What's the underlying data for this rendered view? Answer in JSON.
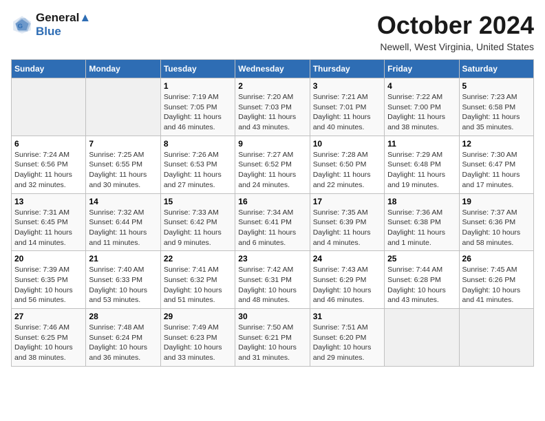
{
  "header": {
    "logo_line1": "General",
    "logo_line2": "Blue",
    "month": "October 2024",
    "location": "Newell, West Virginia, United States"
  },
  "days_of_week": [
    "Sunday",
    "Monday",
    "Tuesday",
    "Wednesday",
    "Thursday",
    "Friday",
    "Saturday"
  ],
  "weeks": [
    [
      {
        "day": "",
        "info": ""
      },
      {
        "day": "",
        "info": ""
      },
      {
        "day": "1",
        "info": "Sunrise: 7:19 AM\nSunset: 7:05 PM\nDaylight: 11 hours and 46 minutes."
      },
      {
        "day": "2",
        "info": "Sunrise: 7:20 AM\nSunset: 7:03 PM\nDaylight: 11 hours and 43 minutes."
      },
      {
        "day": "3",
        "info": "Sunrise: 7:21 AM\nSunset: 7:01 PM\nDaylight: 11 hours and 40 minutes."
      },
      {
        "day": "4",
        "info": "Sunrise: 7:22 AM\nSunset: 7:00 PM\nDaylight: 11 hours and 38 minutes."
      },
      {
        "day": "5",
        "info": "Sunrise: 7:23 AM\nSunset: 6:58 PM\nDaylight: 11 hours and 35 minutes."
      }
    ],
    [
      {
        "day": "6",
        "info": "Sunrise: 7:24 AM\nSunset: 6:56 PM\nDaylight: 11 hours and 32 minutes."
      },
      {
        "day": "7",
        "info": "Sunrise: 7:25 AM\nSunset: 6:55 PM\nDaylight: 11 hours and 30 minutes."
      },
      {
        "day": "8",
        "info": "Sunrise: 7:26 AM\nSunset: 6:53 PM\nDaylight: 11 hours and 27 minutes."
      },
      {
        "day": "9",
        "info": "Sunrise: 7:27 AM\nSunset: 6:52 PM\nDaylight: 11 hours and 24 minutes."
      },
      {
        "day": "10",
        "info": "Sunrise: 7:28 AM\nSunset: 6:50 PM\nDaylight: 11 hours and 22 minutes."
      },
      {
        "day": "11",
        "info": "Sunrise: 7:29 AM\nSunset: 6:48 PM\nDaylight: 11 hours and 19 minutes."
      },
      {
        "day": "12",
        "info": "Sunrise: 7:30 AM\nSunset: 6:47 PM\nDaylight: 11 hours and 17 minutes."
      }
    ],
    [
      {
        "day": "13",
        "info": "Sunrise: 7:31 AM\nSunset: 6:45 PM\nDaylight: 11 hours and 14 minutes."
      },
      {
        "day": "14",
        "info": "Sunrise: 7:32 AM\nSunset: 6:44 PM\nDaylight: 11 hours and 11 minutes."
      },
      {
        "day": "15",
        "info": "Sunrise: 7:33 AM\nSunset: 6:42 PM\nDaylight: 11 hours and 9 minutes."
      },
      {
        "day": "16",
        "info": "Sunrise: 7:34 AM\nSunset: 6:41 PM\nDaylight: 11 hours and 6 minutes."
      },
      {
        "day": "17",
        "info": "Sunrise: 7:35 AM\nSunset: 6:39 PM\nDaylight: 11 hours and 4 minutes."
      },
      {
        "day": "18",
        "info": "Sunrise: 7:36 AM\nSunset: 6:38 PM\nDaylight: 11 hours and 1 minute."
      },
      {
        "day": "19",
        "info": "Sunrise: 7:37 AM\nSunset: 6:36 PM\nDaylight: 10 hours and 58 minutes."
      }
    ],
    [
      {
        "day": "20",
        "info": "Sunrise: 7:39 AM\nSunset: 6:35 PM\nDaylight: 10 hours and 56 minutes."
      },
      {
        "day": "21",
        "info": "Sunrise: 7:40 AM\nSunset: 6:33 PM\nDaylight: 10 hours and 53 minutes."
      },
      {
        "day": "22",
        "info": "Sunrise: 7:41 AM\nSunset: 6:32 PM\nDaylight: 10 hours and 51 minutes."
      },
      {
        "day": "23",
        "info": "Sunrise: 7:42 AM\nSunset: 6:31 PM\nDaylight: 10 hours and 48 minutes."
      },
      {
        "day": "24",
        "info": "Sunrise: 7:43 AM\nSunset: 6:29 PM\nDaylight: 10 hours and 46 minutes."
      },
      {
        "day": "25",
        "info": "Sunrise: 7:44 AM\nSunset: 6:28 PM\nDaylight: 10 hours and 43 minutes."
      },
      {
        "day": "26",
        "info": "Sunrise: 7:45 AM\nSunset: 6:26 PM\nDaylight: 10 hours and 41 minutes."
      }
    ],
    [
      {
        "day": "27",
        "info": "Sunrise: 7:46 AM\nSunset: 6:25 PM\nDaylight: 10 hours and 38 minutes."
      },
      {
        "day": "28",
        "info": "Sunrise: 7:48 AM\nSunset: 6:24 PM\nDaylight: 10 hours and 36 minutes."
      },
      {
        "day": "29",
        "info": "Sunrise: 7:49 AM\nSunset: 6:23 PM\nDaylight: 10 hours and 33 minutes."
      },
      {
        "day": "30",
        "info": "Sunrise: 7:50 AM\nSunset: 6:21 PM\nDaylight: 10 hours and 31 minutes."
      },
      {
        "day": "31",
        "info": "Sunrise: 7:51 AM\nSunset: 6:20 PM\nDaylight: 10 hours and 29 minutes."
      },
      {
        "day": "",
        "info": ""
      },
      {
        "day": "",
        "info": ""
      }
    ]
  ]
}
